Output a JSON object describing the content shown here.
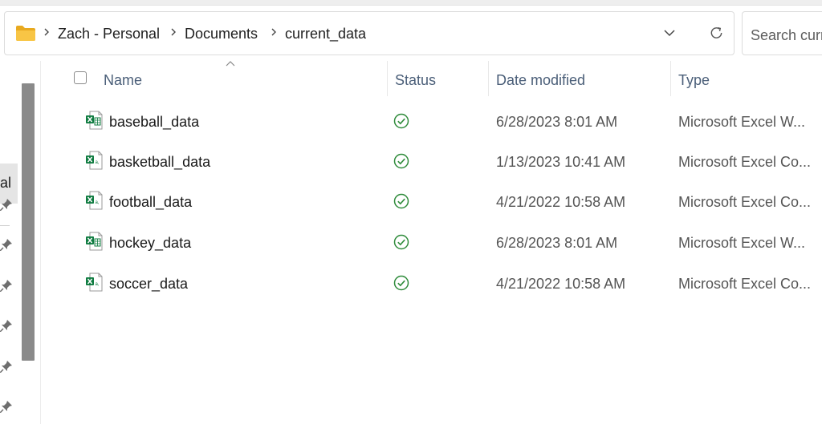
{
  "breadcrumb": {
    "items": [
      "Zach - Personal",
      "Documents",
      "current_data"
    ]
  },
  "search": {
    "placeholder": "Search current_data"
  },
  "nav": {
    "selected_label": "al"
  },
  "columns": {
    "name": "Name",
    "status": "Status",
    "date_modified": "Date modified",
    "type": "Type"
  },
  "files": [
    {
      "name": "baseball_data",
      "date": "6/28/2023 8:01 AM",
      "type": "Microsoft Excel W...",
      "icon": "excel-workbook-icon",
      "status": "synced-icon"
    },
    {
      "name": "basketball_data",
      "date": "1/13/2023 10:41 AM",
      "type": "Microsoft Excel Co...",
      "icon": "excel-csv-icon",
      "status": "synced-icon"
    },
    {
      "name": "football_data",
      "date": "4/21/2022 10:58 AM",
      "type": "Microsoft Excel Co...",
      "icon": "excel-csv-icon",
      "status": "synced-icon"
    },
    {
      "name": "hockey_data",
      "date": "6/28/2023 8:01 AM",
      "type": "Microsoft Excel W...",
      "icon": "excel-workbook-icon",
      "status": "synced-icon"
    },
    {
      "name": "soccer_data",
      "date": "4/21/2022 10:58 AM",
      "type": "Microsoft Excel Co...",
      "icon": "excel-csv-icon",
      "status": "synced-icon"
    }
  ],
  "colors": {
    "excel_green": "#107c41",
    "status_green": "#2e8b3a",
    "folder_yellow": "#f8c545",
    "header_text": "#4a5e78"
  }
}
